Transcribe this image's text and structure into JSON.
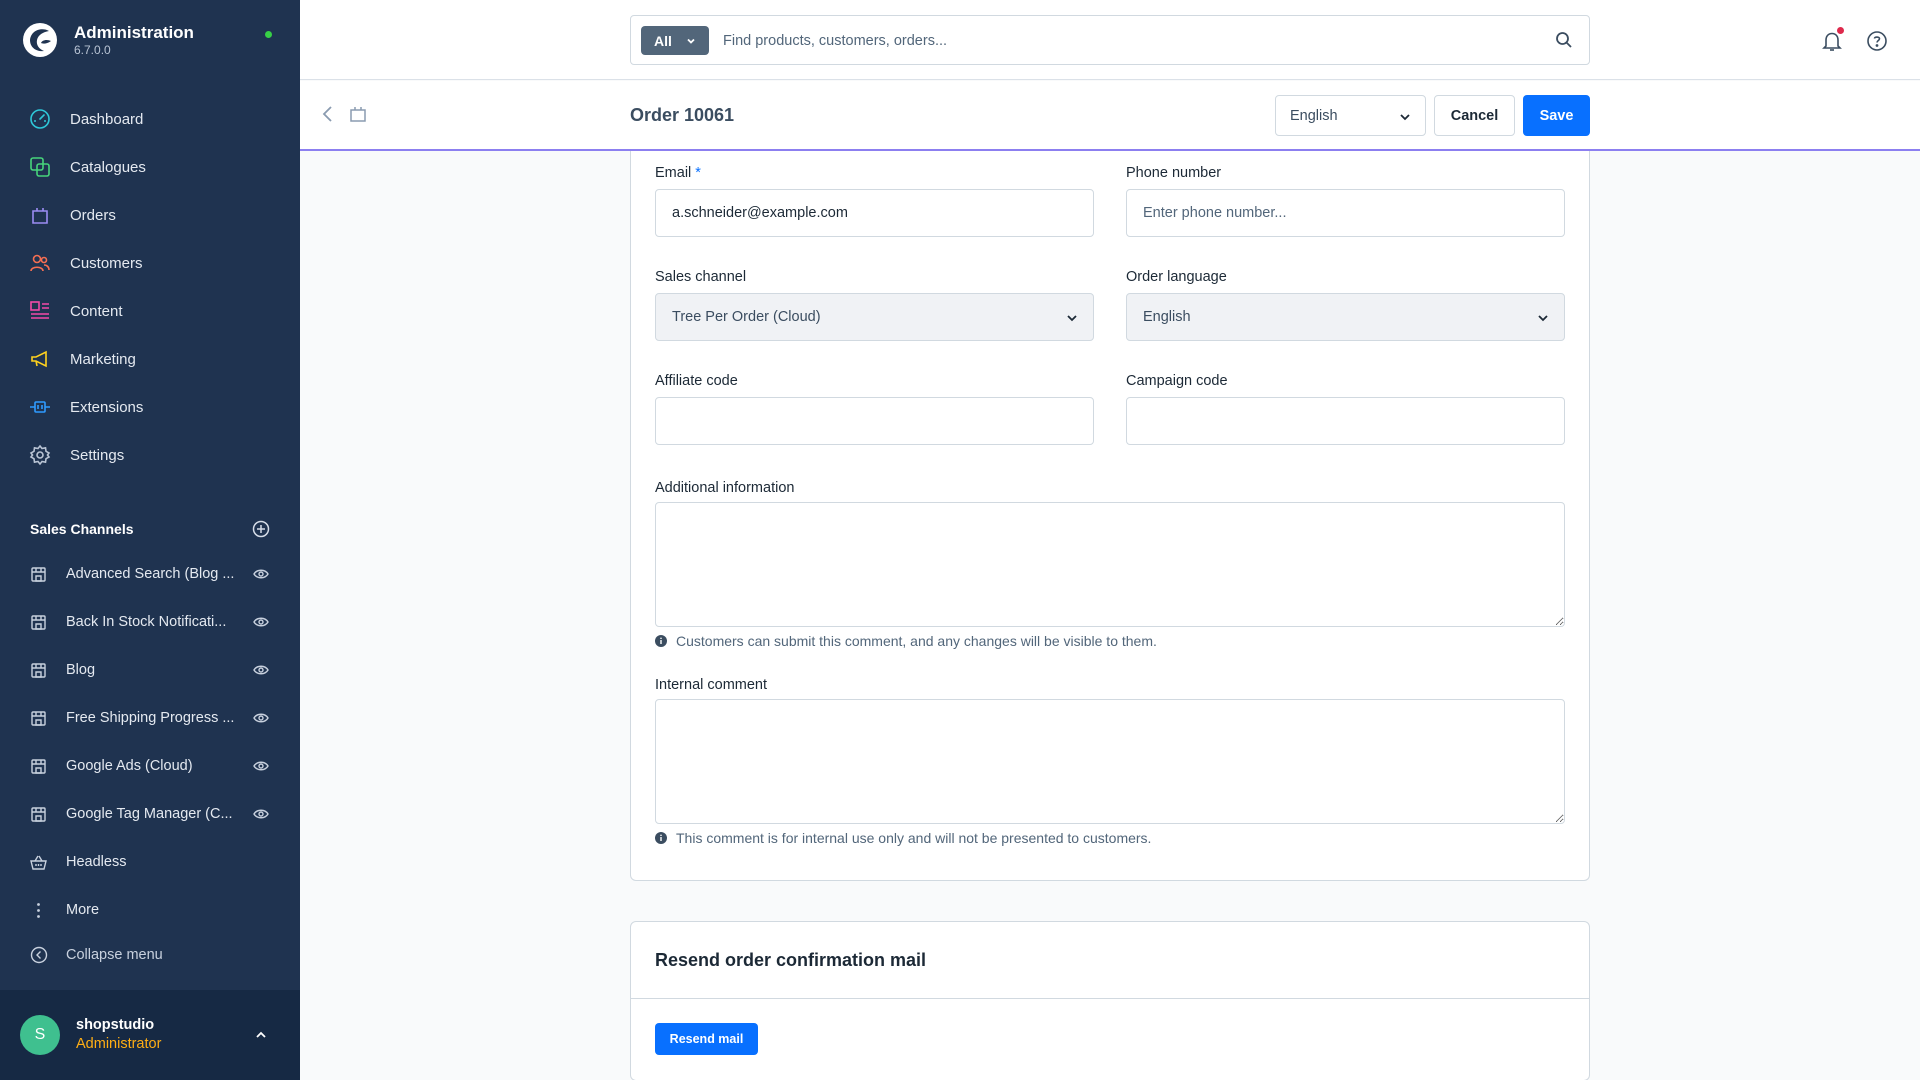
{
  "app": {
    "title": "Administration",
    "version": "6.7.0.0"
  },
  "sidebar": {
    "nav": [
      {
        "label": "Dashboard",
        "icon": "dashboard-icon",
        "color": "#2ec8d9"
      },
      {
        "label": "Catalogues",
        "icon": "catalogue-icon",
        "color": "#47d47b"
      },
      {
        "label": "Orders",
        "icon": "shopping-bag-icon",
        "color": "#9b8cf2"
      },
      {
        "label": "Customers",
        "icon": "customers-icon",
        "color": "#f76f52"
      },
      {
        "label": "Content",
        "icon": "content-icon",
        "color": "#f34ba8"
      },
      {
        "label": "Marketing",
        "icon": "megaphone-icon",
        "color": "#ffd21e"
      },
      {
        "label": "Extensions",
        "icon": "plug-icon",
        "color": "#2f9bff"
      },
      {
        "label": "Settings",
        "icon": "gear-icon",
        "color": "#b9c4d4"
      }
    ],
    "sales_channels_title": "Sales Channels",
    "sales_channels": [
      {
        "label": "Advanced Search (Blog ...",
        "visible": true
      },
      {
        "label": "Back In Stock Notificati...",
        "visible": true
      },
      {
        "label": "Blog",
        "visible": true
      },
      {
        "label": "Free Shipping Progress ...",
        "visible": true
      },
      {
        "label": "Google Ads (Cloud)",
        "visible": true
      },
      {
        "label": "Google Tag Manager (C...",
        "visible": true
      },
      {
        "label": "Headless",
        "visible": false
      },
      {
        "label": "More",
        "visible": false
      }
    ],
    "collapse_label": "Collapse menu",
    "user": {
      "initial": "S",
      "name": "shopstudio",
      "role": "Administrator"
    }
  },
  "search": {
    "type_label": "All",
    "placeholder": "Find products, customers, orders..."
  },
  "smartbar": {
    "title": "Order 10061",
    "language": "English",
    "cancel_label": "Cancel",
    "save_label": "Save"
  },
  "form": {
    "email": {
      "label": "Email",
      "required_mark": "*",
      "value": "a.schneider@example.com"
    },
    "phone": {
      "label": "Phone number",
      "value": "",
      "placeholder": "Enter phone number..."
    },
    "sales_channel": {
      "label": "Sales channel",
      "value": "Tree Per Order (Cloud)"
    },
    "order_language": {
      "label": "Order language",
      "value": "English"
    },
    "affiliate_code": {
      "label": "Affiliate code",
      "value": ""
    },
    "campaign_code": {
      "label": "Campaign code",
      "value": ""
    },
    "additional_info": {
      "label": "Additional information",
      "value": "",
      "hint": "Customers can submit this comment, and any changes will be visible to them."
    },
    "internal_comment": {
      "label": "Internal comment",
      "value": "",
      "hint": "This comment is for internal use only and will not be presented to customers."
    }
  },
  "resend": {
    "title": "Resend order confirmation mail",
    "button_label": "Resend mail"
  },
  "colors": {
    "sidebar_bg": "#1f3350",
    "primary": "#0870ff",
    "accent_line": "#8c7ff0",
    "role_color": "#ffae14",
    "avatar_bg": "#3fc08f"
  }
}
